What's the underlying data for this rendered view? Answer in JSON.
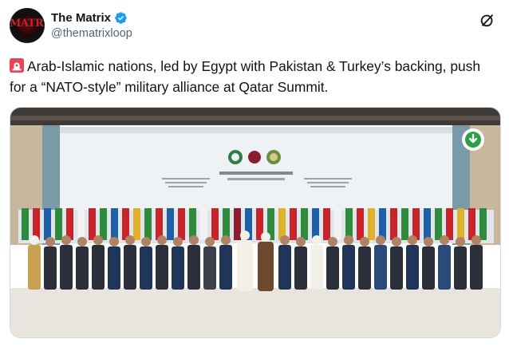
{
  "author": {
    "display_name": "The Matrix",
    "handle": "@thematrixloop",
    "avatar_text": "MATRIX",
    "verified": true
  },
  "tweet": {
    "emoji": "siren-icon",
    "text": "Arab-Islamic nations, led by Egypt with Pakistan & Turkey’s backing, push for a “NATO-style” military alliance at Qatar Summit."
  },
  "media": {
    "type": "photo",
    "description_icon": "download-icon",
    "colors": {
      "backdrop": "#eef2f5",
      "ceiling": "#3f3a35",
      "curtain": "#c9b79d",
      "floor": "#e9e5de",
      "accent_green": "#2ea043"
    }
  },
  "colors": {
    "text": "#0f1419",
    "secondary": "#536471",
    "verified": "#1d9bf0",
    "border": "#cfd9de"
  }
}
